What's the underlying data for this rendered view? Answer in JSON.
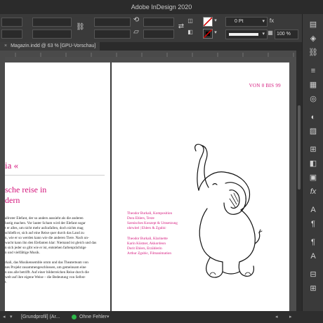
{
  "window": {
    "title": "Adobe InDesign 2020"
  },
  "control_bar": {
    "stroke_weight": "0 Pt",
    "zoom": "100 %",
    "fill_color_hex": "#ffffff",
    "stroke_swatch_hex": "#000000",
    "none_swatch_color": "#d40000"
  },
  "document_tab": {
    "label": "Magazin.indd @ 63 % [GPU-Vorschau]",
    "close_glyph": "×"
  },
  "layout": {
    "left_page": {
      "title_fragment": "ia «",
      "subtitle_line1": "sche reise in",
      "subtitle_line2": "dern",
      "body_lines": [
        "allroter Elefant, der so anders aussieht als die anderen",
        "lustig machen. Vor lauter Scham wird der Elefant sogar",
        "t er alles, um nicht mehr aufzufallen, doch nichts mag",
        "schließt er, sich auf eine Reise quer durch das Land zu",
        "n, wie er so werden kann wie die anderen Tiere. Nach un-",
        "wacht kann ihn den Elefanten klar: Niemand ist gleich und das",
        "n sich jeder so gibt wie er ist, entstehen farbenprächtige",
        "n und vielfältige Musik.",
        "",
        "rkali, das Musikensemble ornm und das Theaterteam von",
        "nes Projekt zusammengeschlossen, um gemeinsam eine",
        "n uns alle betrifft. Auf einer bilderreichen Reise durch die",
        "welt auf ihre eigene Weise – die Bedeutung von Selbst-",
        "t."
      ]
    },
    "right_page": {
      "header": "VON 0 BIS 99",
      "credits_block1": [
        "Theodor Burkali, Komposition",
        "Dora Ehlers, Texte",
        "Szenisches Konzept & Umsetzung",
        "ohrwitel | Ehlers & Zgubic"
      ],
      "credits_block2": [
        "Theodor Burkali, Klarinette",
        "Karin Küstner, Akkordeon",
        "Dorit Ehlers, Erzählerin",
        "Arthur Zgubic, Filmanimation"
      ]
    }
  },
  "status_bar": {
    "profile": "[Grundprofil] (Ar...",
    "status_dot_color": "#2db84a",
    "preflight": "Ohne Fehler"
  },
  "panel_icons": [
    "pages-icon",
    "layers-icon",
    "links-icon",
    "stroke-icon",
    "swatches-icon",
    "cc-libraries-icon",
    "color-icon",
    "gradient-icon",
    "align-icon",
    "effects-icon",
    "text-wrap-icon",
    "character-icon",
    "paragraph-icon",
    "paragraph-styles-icon",
    "character-styles-icon",
    "table-icon",
    "glyphs-icon"
  ],
  "brand_color": "#d4147b"
}
